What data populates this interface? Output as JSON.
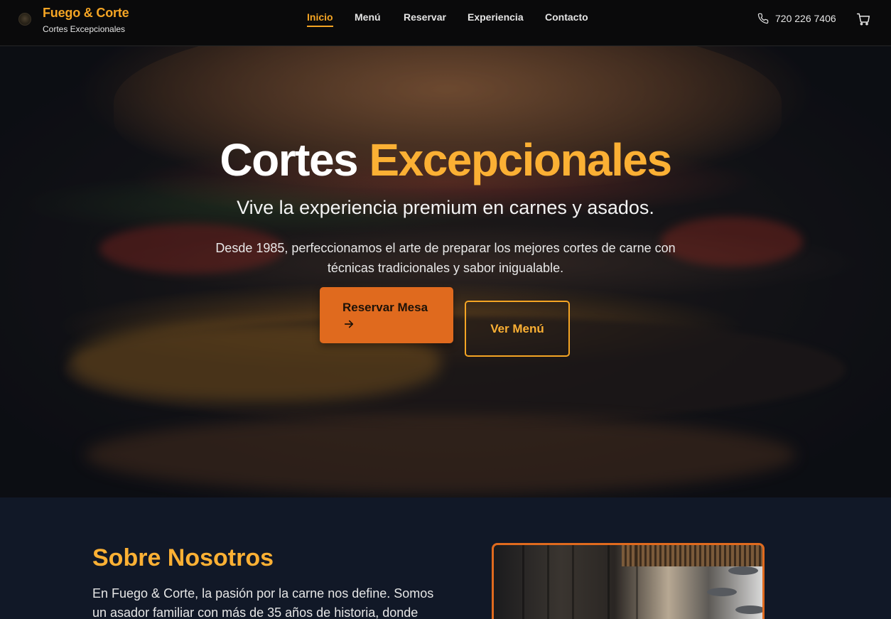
{
  "brand": {
    "name": "Fuego & Corte",
    "tagline": "Cortes Excepcionales"
  },
  "nav": {
    "items": [
      {
        "label": "Inicio",
        "active": true
      },
      {
        "label": "Menú",
        "active": false
      },
      {
        "label": "Reservar",
        "active": false
      },
      {
        "label": "Experiencia",
        "active": false
      },
      {
        "label": "Contacto",
        "active": false
      }
    ]
  },
  "header": {
    "phone": "720 226 7406"
  },
  "hero": {
    "title_white": "Cortes ",
    "title_accent": "Excepcionales",
    "subtitle": "Vive la experiencia premium en carnes y asados.",
    "description": "Desde 1985, perfeccionamos el arte de preparar los mejores cortes de carne con técnicas tradicionales y sabor inigualable.",
    "primary_button": "Reservar Mesa",
    "secondary_button": "Ver Menú"
  },
  "about": {
    "title": "Sobre Nosotros",
    "text": "En Fuego & Corte, la pasión por la carne nos define. Somos un asador familiar con más de 35 años de historia, donde"
  },
  "colors": {
    "accent": "#f5a524",
    "button": "#e06a1e",
    "header_bg": "#0a0a0b",
    "section_bg": "#111827"
  },
  "icons": {
    "phone": "phone-icon",
    "cart": "cart-icon",
    "arrow": "arrow-right-icon",
    "logo": "logo-icon"
  }
}
